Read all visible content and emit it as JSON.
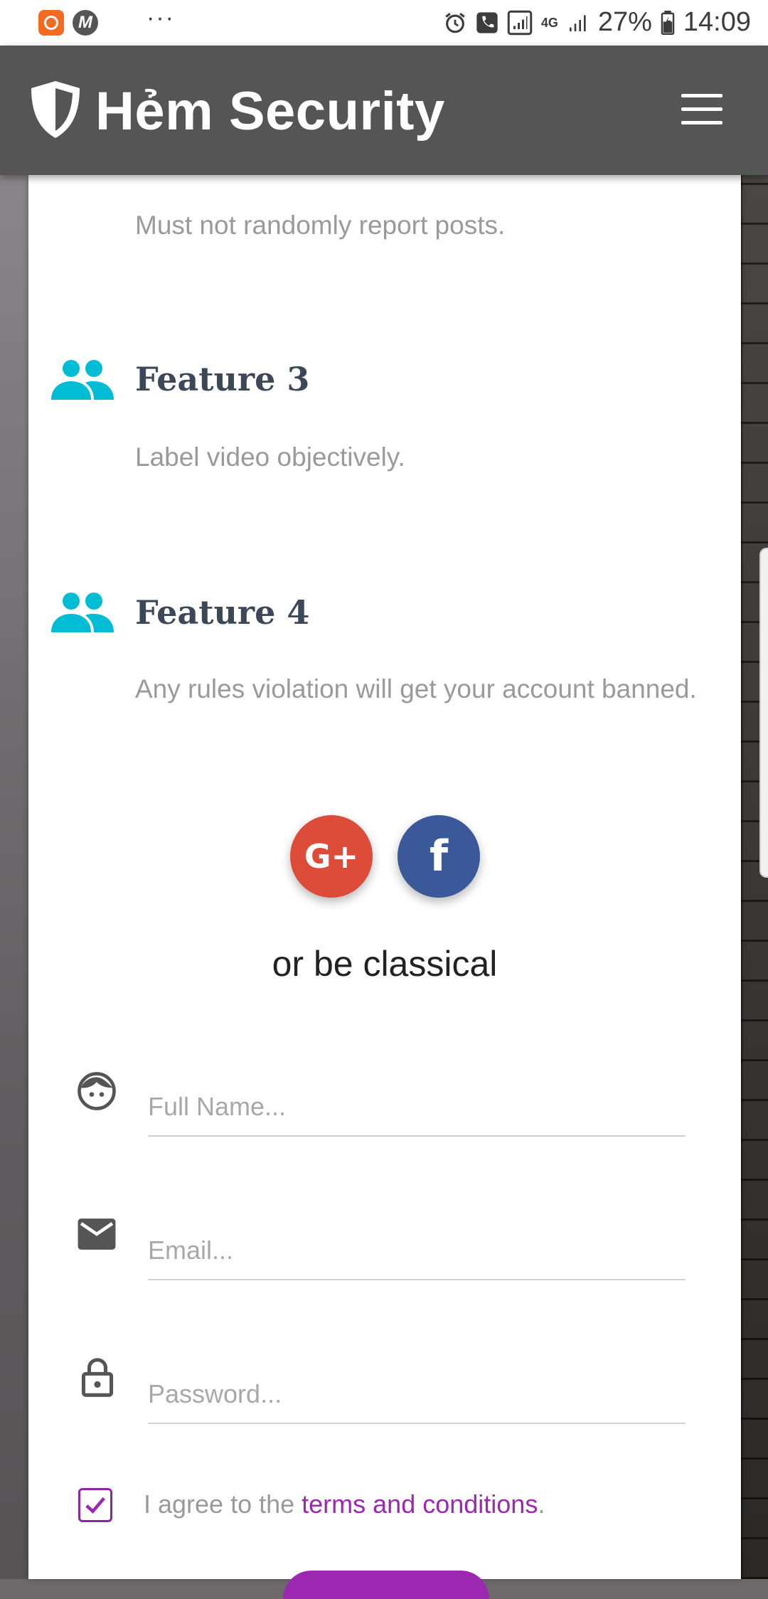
{
  "status_bar": {
    "more_indicator": "···",
    "network": "4G",
    "battery": "27%",
    "time": "14:09"
  },
  "app_bar": {
    "title": "Hẻm Security",
    "logo_icon": "shield-icon",
    "menu_icon": "hamburger-icon"
  },
  "features": {
    "partial_description": "Must not randomly report posts.",
    "items": [
      {
        "icon": "people-icon",
        "title": "Feature 3",
        "description": "Label video objectively."
      },
      {
        "icon": "people-icon",
        "title": "Feature 4",
        "description": "Any rules violation will get your account banned."
      }
    ]
  },
  "social": {
    "google_label": "G+",
    "facebook_label": "f"
  },
  "classical_text": "or be classical",
  "form": {
    "full_name_placeholder": "Full Name...",
    "email_placeholder": "Email...",
    "password_placeholder": "Password...",
    "agree_prefix": "I agree to the ",
    "terms_link": "terms and conditions",
    "agree_suffix": ".",
    "agree_checked": true
  },
  "colors": {
    "app_bar": "#555555",
    "accent_icon": "#00bcd4",
    "google": "#dd4b39",
    "facebook": "#3b5998",
    "primary": "#9c27b0"
  }
}
